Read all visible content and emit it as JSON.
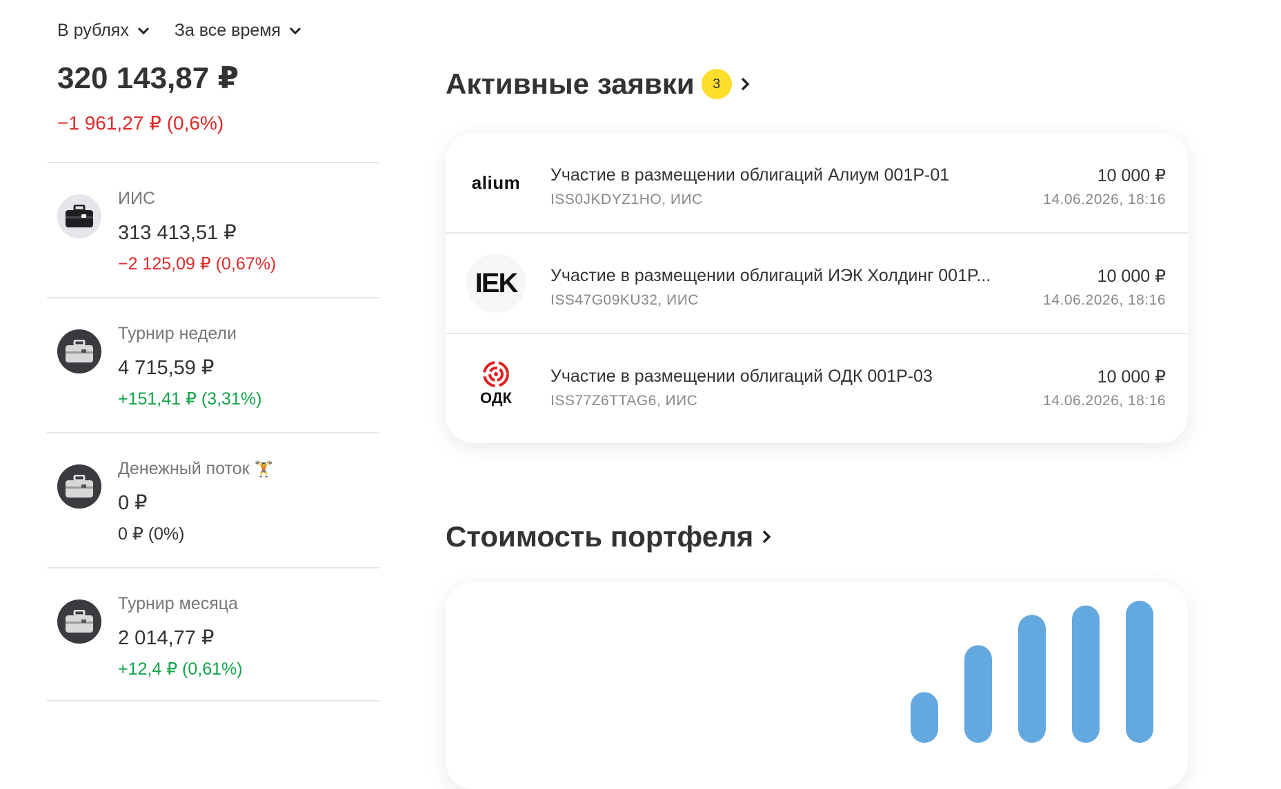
{
  "filters": {
    "currency": "В рублях",
    "period": "За все время"
  },
  "portfolio": {
    "total": "320 143,87 ₽",
    "change": "−1 961,27 ₽ (0,6%)"
  },
  "accounts": [
    {
      "name": "ИИС",
      "value": "313 413,51 ₽",
      "change": "−2 125,09 ₽ (0,67%)",
      "trend": "negative"
    },
    {
      "name": "Турнир недели",
      "value": "4 715,59 ₽",
      "change": "+151,41 ₽ (3,31%)",
      "trend": "positive"
    },
    {
      "name": "Денежный поток",
      "value": "0 ₽",
      "change": "0 ₽ (0%)",
      "trend": "neutral",
      "emoji": "🏋️"
    },
    {
      "name": "Турнир месяца",
      "value": "2 014,77 ₽",
      "change": "+12,4 ₽ (0,61%)",
      "trend": "positive"
    }
  ],
  "active_orders": {
    "title": "Активные заявки",
    "count": "3",
    "items": [
      {
        "logo_text": "alium",
        "title": "Участие в размещении облигаций Алиум 001P-01",
        "sub": "ISS0JKDYZ1HO, ИИС",
        "amount": "10 000 ₽",
        "date": "14.06.2026, 18:16"
      },
      {
        "logo_text": "IEK",
        "title": "Участие в размещении облигаций ИЭК Холдинг 001P...",
        "sub": "ISS47G09KU32, ИИС",
        "amount": "10 000 ₽",
        "date": "14.06.2026, 18:16"
      },
      {
        "logo_text": "ОДК",
        "title": "Участие в размещении облигаций ОДК 001P-03",
        "sub": "ISS77Z6TTAG6, ИИС",
        "amount": "10 000 ₽",
        "date": "14.06.2026, 18:16"
      }
    ]
  },
  "portfolio_value": {
    "title": "Стоимость портфеля"
  },
  "chart_data": {
    "type": "bar",
    "bar_color": "#64a8e0",
    "values": [
      0.08,
      0.48,
      0.74,
      0.82,
      0.86
    ],
    "note": "relative heights of visible bars, cropped at bottom"
  },
  "colors": {
    "accent_yellow": "#ffdd2d",
    "negative": "#dd2a2a",
    "positive": "#14a34a",
    "bar_blue": "#64a8e0"
  }
}
